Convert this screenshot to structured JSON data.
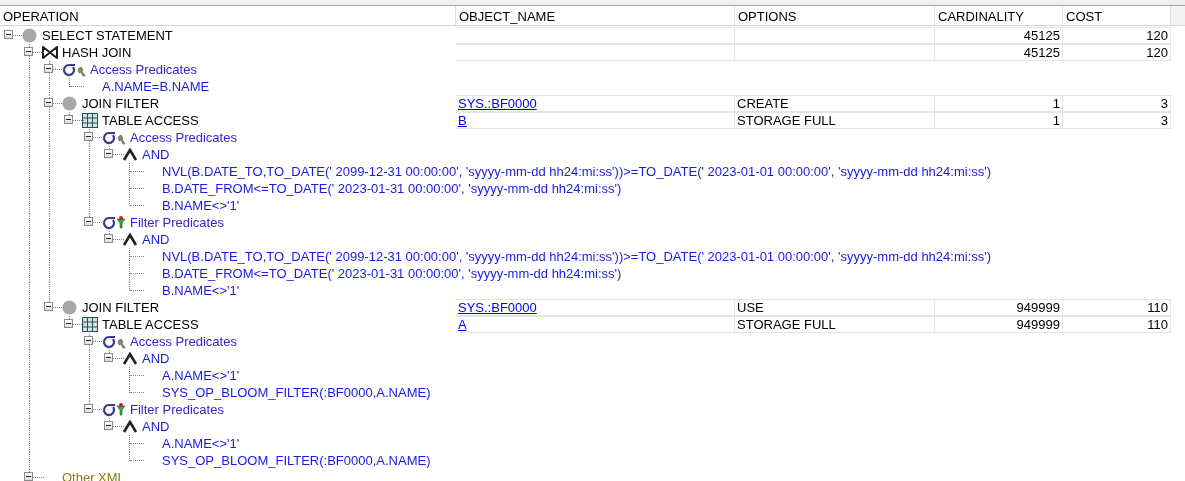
{
  "columns": [
    "OPERATION",
    "OBJECT_NAME",
    "OPTIONS",
    "CARDINALITY",
    "COST"
  ],
  "plan": [
    {
      "kind": "select",
      "label": "SELECT STATEMENT",
      "expanded": true,
      "cardinality": "45125",
      "cost": "120",
      "children": [
        {
          "kind": "hash_join",
          "label": "HASH JOIN",
          "expanded": true,
          "cardinality": "45125",
          "cost": "120",
          "children": [
            {
              "kind": "access",
              "label": "Access Predicates",
              "expanded": true,
              "children": [
                {
                  "kind": "predicate",
                  "label": "A.NAME=B.NAME"
                }
              ]
            },
            {
              "kind": "join_filter",
              "label": "JOIN FILTER",
              "expanded": true,
              "object_name": "SYS.:BF0000",
              "options": "CREATE",
              "cardinality": "1",
              "cost": "3",
              "children": [
                {
                  "kind": "table_access",
                  "label": "TABLE ACCESS",
                  "expanded": true,
                  "object_name": "B",
                  "options": "STORAGE FULL",
                  "cardinality": "1",
                  "cost": "3",
                  "children": [
                    {
                      "kind": "access",
                      "label": "Access Predicates",
                      "expanded": true,
                      "children": [
                        {
                          "kind": "and",
                          "label": "AND",
                          "expanded": true,
                          "children": [
                            {
                              "kind": "predicate",
                              "label": "NVL(B.DATE_TO,TO_DATE(' 2099-12-31 00:00:00', 'syyyy-mm-dd hh24:mi:ss'))>=TO_DATE(' 2023-01-01 00:00:00', 'syyyy-mm-dd hh24:mi:ss')"
                            },
                            {
                              "kind": "predicate",
                              "label": "B.DATE_FROM<=TO_DATE(' 2023-01-31 00:00:00', 'syyyy-mm-dd hh24:mi:ss')"
                            },
                            {
                              "kind": "predicate",
                              "label": "B.NAME<>'1'"
                            }
                          ]
                        }
                      ]
                    },
                    {
                      "kind": "filter",
                      "label": "Filter Predicates",
                      "expanded": true,
                      "children": [
                        {
                          "kind": "and",
                          "label": "AND",
                          "expanded": true,
                          "children": [
                            {
                              "kind": "predicate",
                              "label": "NVL(B.DATE_TO,TO_DATE(' 2099-12-31 00:00:00', 'syyyy-mm-dd hh24:mi:ss'))>=TO_DATE(' 2023-01-01 00:00:00', 'syyyy-mm-dd hh24:mi:ss')"
                            },
                            {
                              "kind": "predicate",
                              "label": "B.DATE_FROM<=TO_DATE(' 2023-01-31 00:00:00', 'syyyy-mm-dd hh24:mi:ss')"
                            },
                            {
                              "kind": "predicate",
                              "label": "B.NAME<>'1'"
                            }
                          ]
                        }
                      ]
                    }
                  ]
                }
              ]
            },
            {
              "kind": "join_filter",
              "label": "JOIN FILTER",
              "expanded": true,
              "object_name": "SYS.:BF0000",
              "options": "USE",
              "cardinality": "949999",
              "cost": "110",
              "children": [
                {
                  "kind": "table_access",
                  "label": "TABLE ACCESS",
                  "expanded": true,
                  "object_name": "A",
                  "options": "STORAGE FULL",
                  "cardinality": "949999",
                  "cost": "110",
                  "children": [
                    {
                      "kind": "access",
                      "label": "Access Predicates",
                      "expanded": true,
                      "children": [
                        {
                          "kind": "and",
                          "label": "AND",
                          "expanded": true,
                          "children": [
                            {
                              "kind": "predicate",
                              "label": "A.NAME<>'1'"
                            },
                            {
                              "kind": "predicate",
                              "label": "SYS_OP_BLOOM_FILTER(:BF0000,A.NAME)"
                            }
                          ]
                        }
                      ]
                    },
                    {
                      "kind": "filter",
                      "label": "Filter Predicates",
                      "expanded": true,
                      "children": [
                        {
                          "kind": "and",
                          "label": "AND",
                          "expanded": true,
                          "children": [
                            {
                              "kind": "predicate",
                              "label": "A.NAME<>'1'"
                            },
                            {
                              "kind": "predicate",
                              "label": "SYS_OP_BLOOM_FILTER(:BF0000,A.NAME)"
                            }
                          ]
                        }
                      ]
                    }
                  ]
                }
              ]
            }
          ]
        },
        {
          "kind": "other_xml",
          "label": "Other XML",
          "expanded": true
        }
      ]
    }
  ]
}
